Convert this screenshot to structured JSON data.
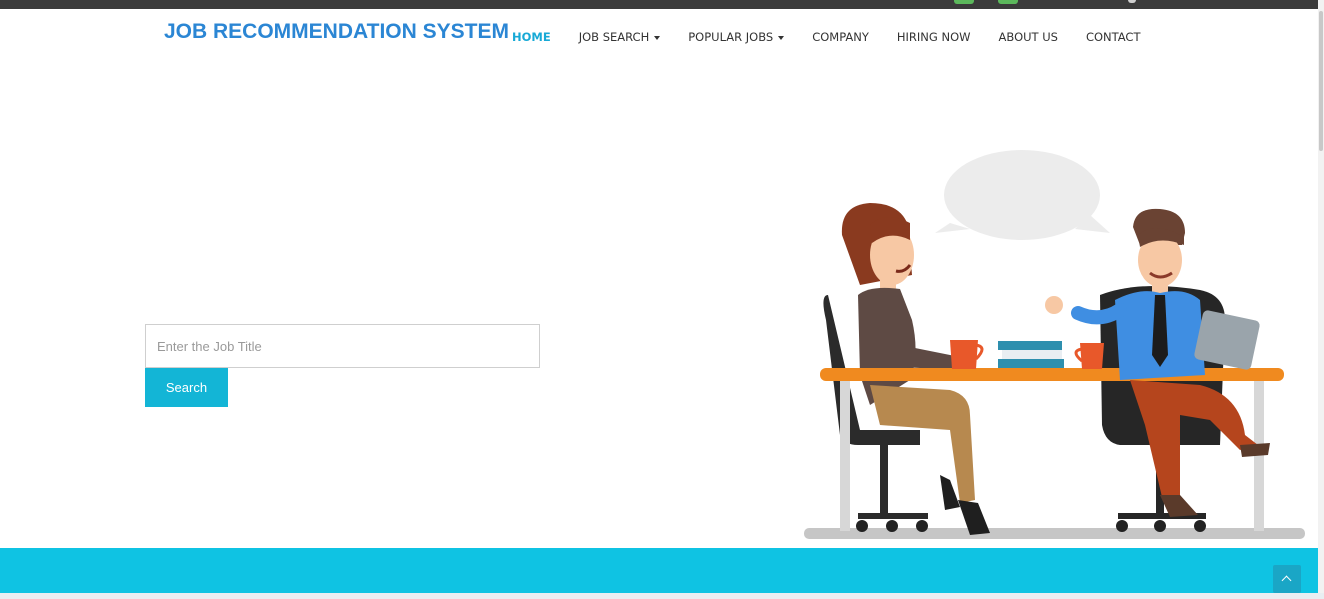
{
  "brand": {
    "title": "JOB RECOMMENDATION SYSTEM"
  },
  "nav": {
    "home": "HOME",
    "job_search": "JOB SEARCH",
    "popular_jobs": "POPULAR JOBS",
    "company": "COMPANY",
    "hiring_now": "HIRING NOW",
    "about_us": "ABOUT US",
    "contact": "CONTACT"
  },
  "search": {
    "placeholder": "Enter the Job Title",
    "value": "",
    "button_label": "Search"
  },
  "colors": {
    "brand": "#2b86d4",
    "nav_active": "#17a9d6",
    "button": "#13b5d6",
    "footer_band": "#0fc3e3",
    "topbar": "#3b3b3b"
  },
  "icons": {
    "top_bar_left": "social-icon",
    "top_bar_right": "social-icon",
    "back_to_top": "chevron-up-icon",
    "dropdown": "caret-down-icon"
  }
}
